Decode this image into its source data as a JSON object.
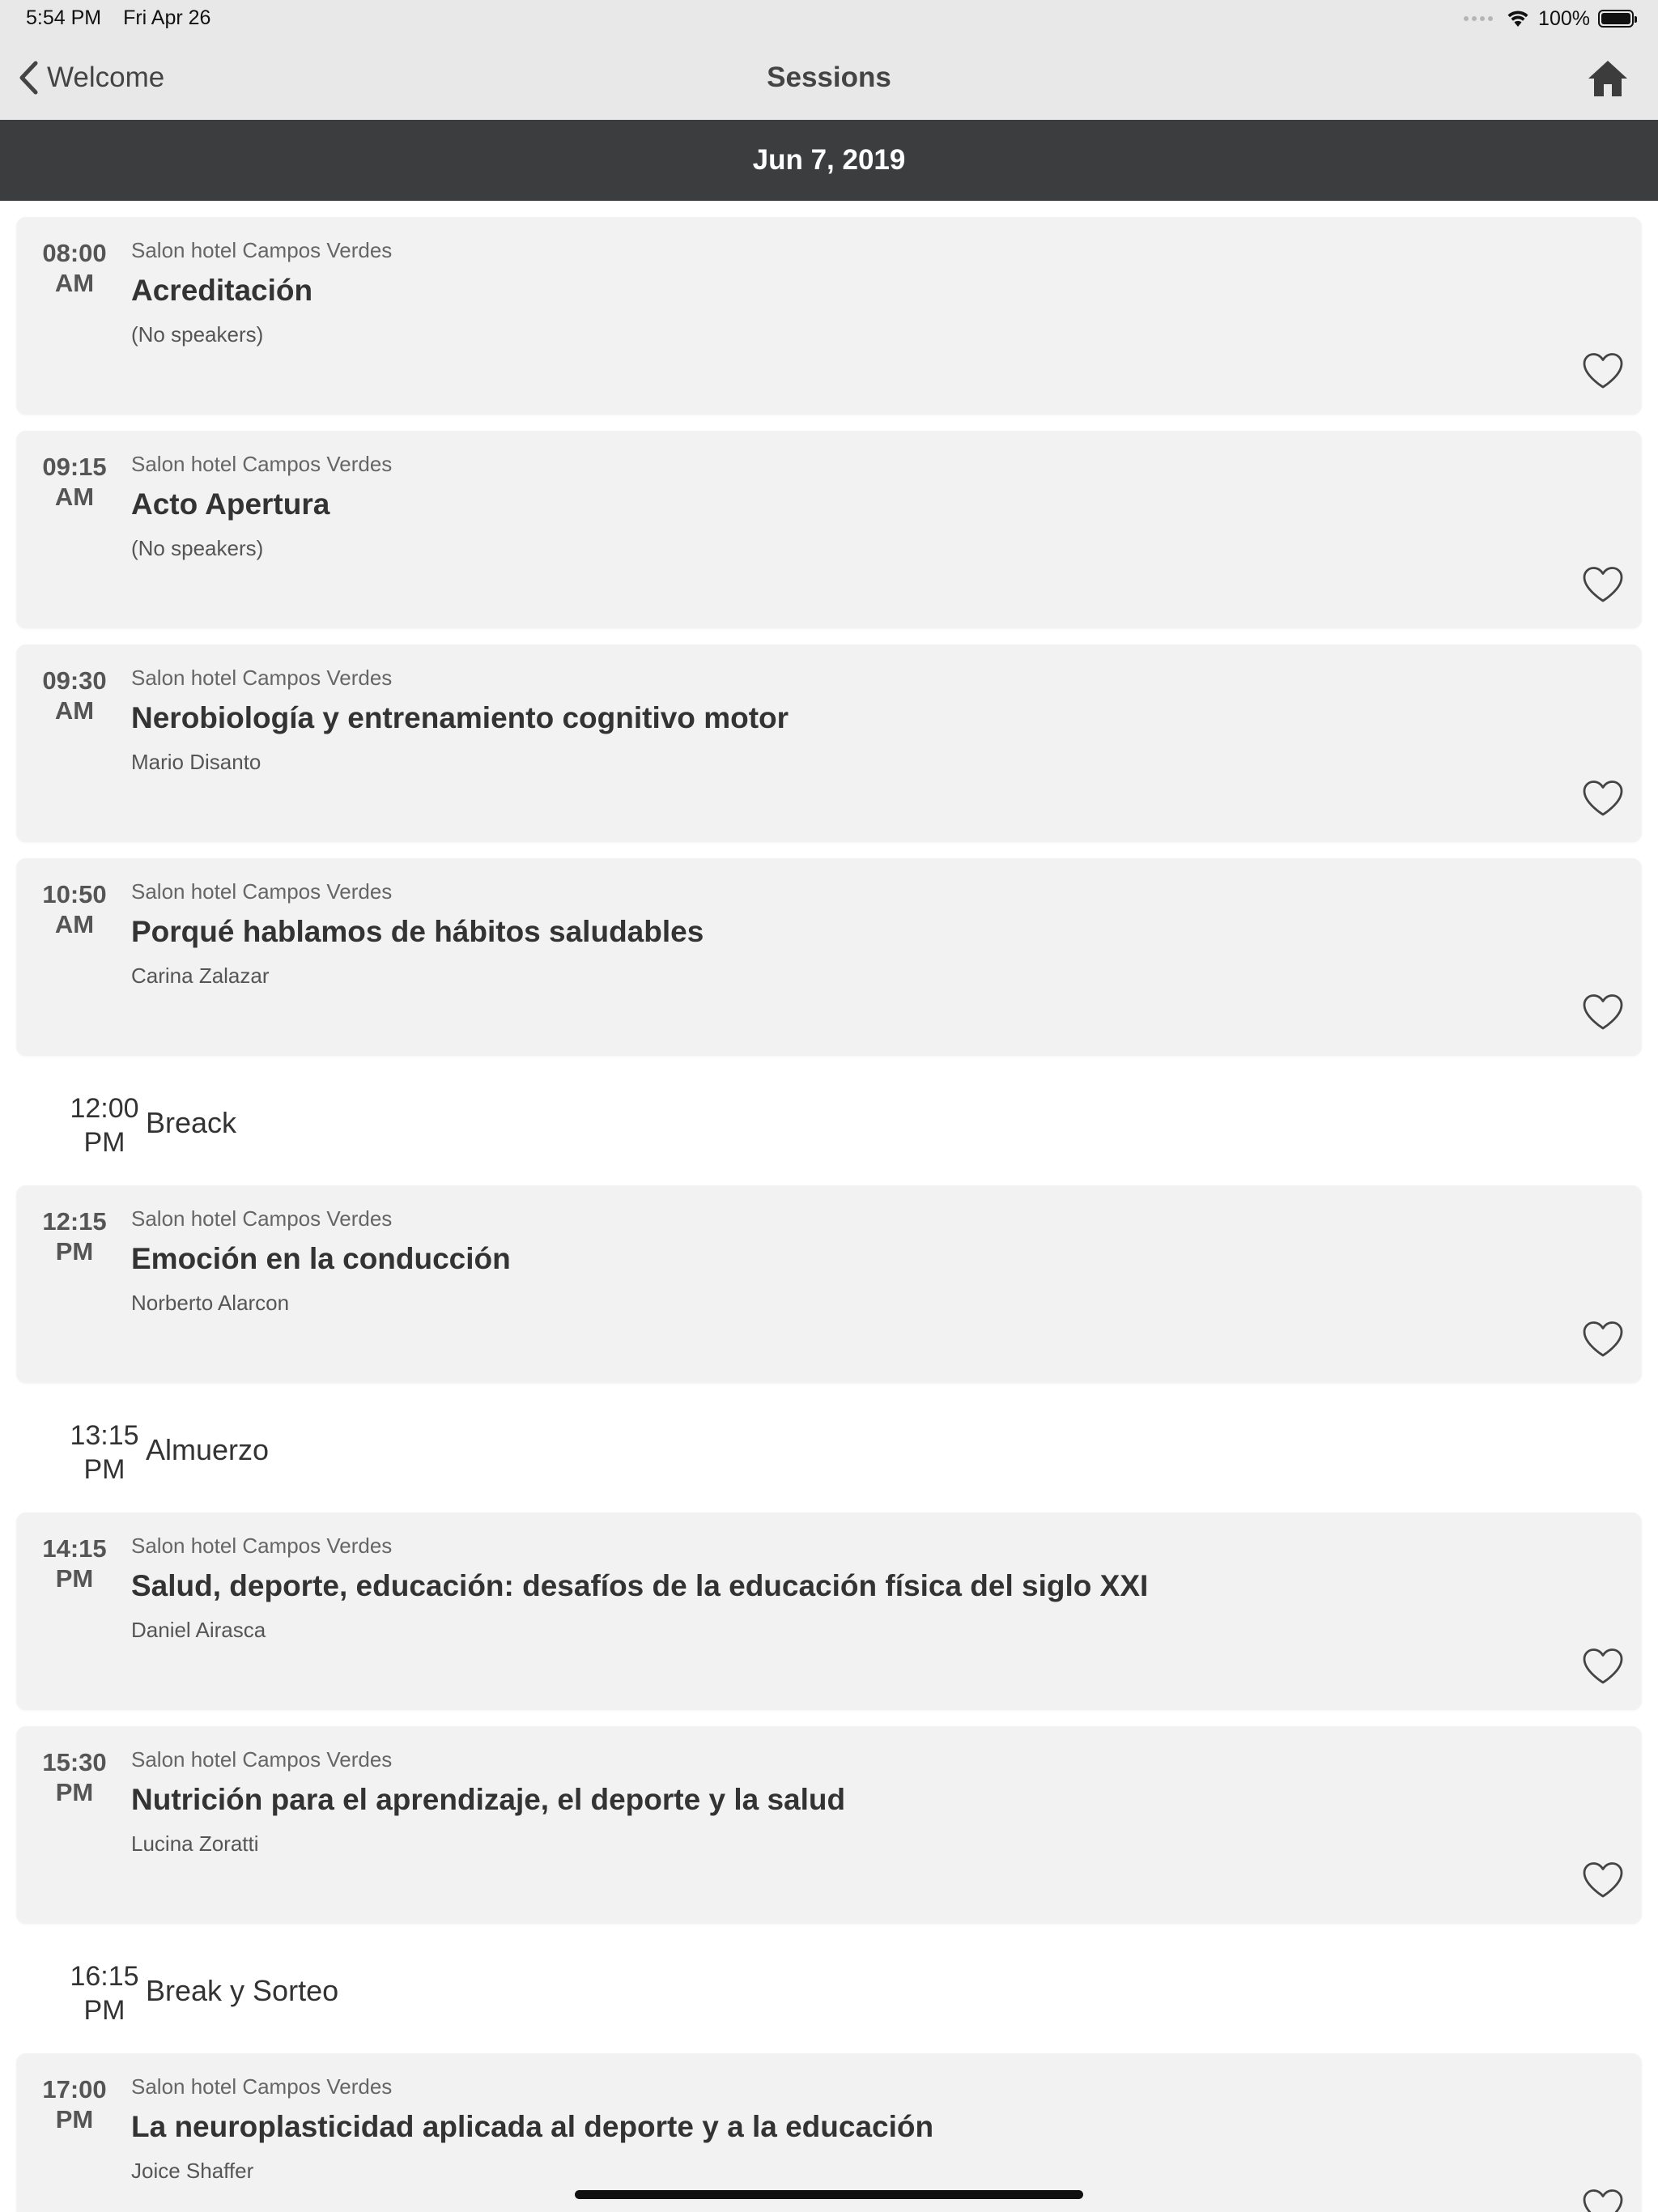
{
  "status_bar": {
    "time": "5:54 PM",
    "date": "Fri Apr 26",
    "battery": "100%"
  },
  "nav": {
    "back_label": "Welcome",
    "title": "Sessions"
  },
  "date_header": "Jun 7, 2019",
  "sessions": [
    {
      "time_top": "08:00",
      "time_bottom": "AM",
      "location": "Salon hotel Campos Verdes",
      "title": "Acreditación",
      "speakers": "(No speakers)"
    },
    {
      "time_top": "09:15",
      "time_bottom": "AM",
      "location": "Salon hotel Campos Verdes",
      "title": "Acto Apertura",
      "speakers": "(No speakers)"
    },
    {
      "time_top": "09:30",
      "time_bottom": "AM",
      "location": "Salon hotel Campos Verdes",
      "title": "Nerobiología y entrenamiento cognitivo motor",
      "speakers": "Mario Disanto"
    },
    {
      "time_top": "10:50",
      "time_bottom": "AM",
      "location": "Salon hotel Campos Verdes",
      "title": "Porqué hablamos de hábitos saludables",
      "speakers": "Carina Zalazar"
    },
    {
      "time_top": "12:15",
      "time_bottom": "PM",
      "location": "Salon hotel Campos Verdes",
      "title": "Emoción en la conducción",
      "speakers": "Norberto Alarcon"
    },
    {
      "time_top": "14:15",
      "time_bottom": "PM",
      "location": "Salon hotel Campos Verdes",
      "title": "Salud, deporte, educación: desafíos de la educación física del siglo XXI",
      "speakers": "Daniel Airasca"
    },
    {
      "time_top": "15:30",
      "time_bottom": "PM",
      "location": "Salon hotel Campos Verdes",
      "title": "Nutrición para el aprendizaje, el deporte y la salud",
      "speakers": "Lucina Zoratti"
    },
    {
      "time_top": "17:00",
      "time_bottom": "PM",
      "location": "Salon hotel Campos Verdes",
      "title": "La neuroplasticidad aplicada al deporte y a la educación",
      "speakers": "Joice Shaffer"
    }
  ],
  "breaks": [
    {
      "time_top": "12:00",
      "time_bottom": "PM",
      "title": "Breack"
    },
    {
      "time_top": "13:15",
      "time_bottom": "PM",
      "title": "Almuerzo"
    },
    {
      "time_top": "16:15",
      "time_bottom": "PM",
      "title": "Break y Sorteo"
    }
  ]
}
